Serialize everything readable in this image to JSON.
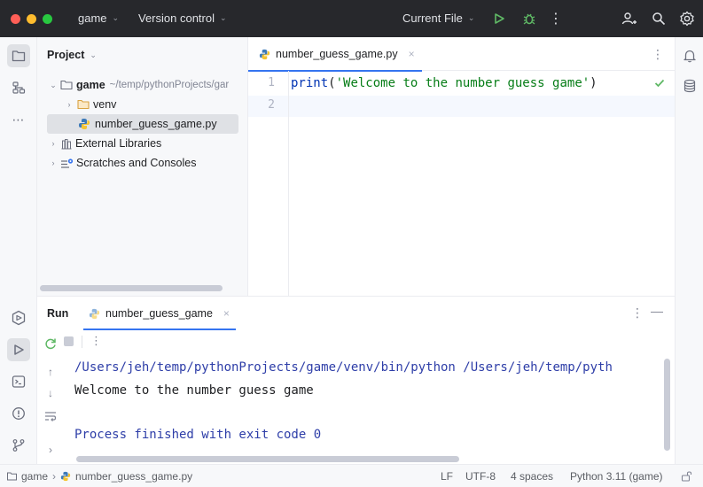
{
  "titlebar": {
    "project_name": "game",
    "vcs_label": "Version control",
    "run_config": "Current File"
  },
  "project_panel": {
    "title": "Project",
    "root_name": "game",
    "root_path": "~/temp/pythonProjects/gar",
    "items": [
      {
        "label": "venv"
      },
      {
        "label": "number_guess_game.py"
      },
      {
        "label": "External Libraries"
      },
      {
        "label": "Scratches and Consoles"
      }
    ]
  },
  "editor": {
    "tab_label": "number_guess_game.py",
    "lines": [
      {
        "number": "1",
        "keyword": "print",
        "open": "(",
        "string": "'Welcome to the number guess game'",
        "close": ")"
      },
      {
        "number": "2",
        "keyword": "",
        "open": "",
        "string": "",
        "close": ""
      }
    ]
  },
  "run_panel": {
    "title": "Run",
    "tab_label": "number_guess_game",
    "console": {
      "command": "/Users/jeh/temp/pythonProjects/game/venv/bin/python /Users/jeh/temp/pyth",
      "output": "Welcome to the number guess game",
      "exit": "Process finished with exit code 0"
    }
  },
  "statusbar": {
    "breadcrumb_root": "game",
    "breadcrumb_file": "number_guess_game.py",
    "line_separator": "LF",
    "encoding": "UTF-8",
    "indent": "4 spaces",
    "interpreter": "Python 3.11 (game)"
  },
  "colors": {
    "accent": "#3574f0",
    "run_green": "#5fb865",
    "close_red": "#ff5f57",
    "minimize_yellow": "#febc2e",
    "zoom_green": "#28c840",
    "folder_orange": "#d9a343",
    "python_blue": "#3d7ab8",
    "python_yellow": "#f5c431"
  },
  "icons": [
    "project-icon",
    "structure-icon",
    "more-icon",
    "run-icon",
    "terminal-icon",
    "problems-icon",
    "git-icon",
    "services-icon",
    "notifications-icon",
    "database-icon",
    "add-user-icon",
    "search-icon",
    "settings-icon",
    "debug-icon",
    "rerun-icon",
    "stop-icon"
  ]
}
